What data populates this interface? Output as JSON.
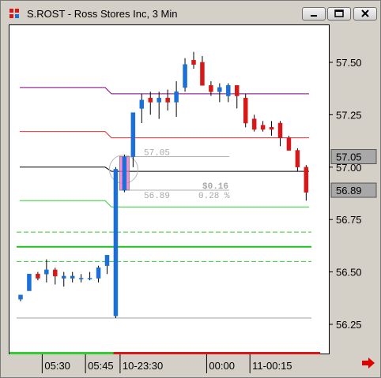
{
  "window": {
    "title": "S.ROST - Ross Stores Inc, 3 Min",
    "buttons": [
      "minimize",
      "restore",
      "close"
    ]
  },
  "chart_data": {
    "type": "candlestick",
    "title": "S.ROST - Ross Stores Inc, 3 Min",
    "ylim": [
      56.22,
      57.62
    ],
    "y_ticks": [
      "57.50",
      "57.25",
      "57.00",
      "56.75",
      "56.50",
      "56.25"
    ],
    "y_tick_values": [
      57.5,
      57.25,
      57.0,
      56.75,
      56.5,
      56.25
    ],
    "x_ticks": [
      "05:30",
      "05:45",
      "10-23:30",
      "00:00",
      "11-00:15"
    ],
    "x_tick_index": [
      2.5,
      7.5,
      11.5,
      21.5,
      26.5
    ],
    "price_flags": [
      {
        "label": "57.05",
        "value": 57.05,
        "color": "#a8a8a8"
      },
      {
        "label": "56.89",
        "value": 56.89,
        "color": "#a8a8a8"
      }
    ],
    "candles": [
      {
        "o": 56.37,
        "h": 56.39,
        "l": 56.36,
        "c": 56.39
      },
      {
        "o": 56.41,
        "h": 56.49,
        "l": 56.41,
        "c": 56.49
      },
      {
        "o": 56.49,
        "h": 56.5,
        "l": 56.46,
        "c": 56.47
      },
      {
        "o": 56.49,
        "h": 56.56,
        "l": 56.45,
        "c": 56.51
      },
      {
        "o": 56.51,
        "h": 56.52,
        "l": 56.44,
        "c": 56.48
      },
      {
        "o": 56.47,
        "h": 56.5,
        "l": 56.43,
        "c": 56.48
      },
      {
        "o": 56.47,
        "h": 56.5,
        "l": 56.45,
        "c": 56.48
      },
      {
        "o": 56.47,
        "h": 56.49,
        "l": 56.45,
        "c": 56.47
      },
      {
        "o": 56.47,
        "h": 56.5,
        "l": 56.46,
        "c": 56.47
      },
      {
        "o": 56.47,
        "h": 56.53,
        "l": 56.45,
        "c": 56.52
      },
      {
        "o": 56.53,
        "h": 56.58,
        "l": 56.49,
        "c": 56.58
      },
      {
        "o": 56.29,
        "h": 57.0,
        "l": 56.28,
        "c": 56.99
      },
      {
        "o": 56.89,
        "h": 57.06,
        "l": 56.88,
        "c": 57.05
      },
      {
        "o": 57.05,
        "h": 57.26,
        "l": 57.0,
        "c": 57.26
      },
      {
        "o": 57.28,
        "h": 57.35,
        "l": 57.21,
        "c": 57.32
      },
      {
        "o": 57.33,
        "h": 57.36,
        "l": 57.25,
        "c": 57.31
      },
      {
        "o": 57.31,
        "h": 57.36,
        "l": 57.23,
        "c": 57.33
      },
      {
        "o": 57.33,
        "h": 57.37,
        "l": 57.27,
        "c": 57.31
      },
      {
        "o": 57.31,
        "h": 57.41,
        "l": 57.24,
        "c": 57.36
      },
      {
        "o": 57.38,
        "h": 57.52,
        "l": 57.36,
        "c": 57.49
      },
      {
        "o": 57.51,
        "h": 57.55,
        "l": 57.47,
        "c": 57.49
      },
      {
        "o": 57.5,
        "h": 57.53,
        "l": 57.39,
        "c": 57.39
      },
      {
        "o": 57.39,
        "h": 57.41,
        "l": 57.34,
        "c": 57.36
      },
      {
        "o": 57.36,
        "h": 57.4,
        "l": 57.31,
        "c": 57.38
      },
      {
        "o": 57.34,
        "h": 57.4,
        "l": 57.31,
        "c": 57.39
      },
      {
        "o": 57.39,
        "h": 57.39,
        "l": 57.28,
        "c": 57.34
      },
      {
        "o": 57.33,
        "h": 57.35,
        "l": 57.19,
        "c": 57.21
      },
      {
        "o": 57.23,
        "h": 57.25,
        "l": 57.17,
        "c": 57.18
      },
      {
        "o": 57.2,
        "h": 57.22,
        "l": 57.17,
        "c": 57.18
      },
      {
        "o": 57.19,
        "h": 57.22,
        "l": 57.15,
        "c": 57.18
      },
      {
        "o": 57.21,
        "h": 57.22,
        "l": 57.1,
        "c": 57.14
      },
      {
        "o": 57.14,
        "h": 57.15,
        "l": 57.08,
        "c": 57.08
      },
      {
        "o": 57.08,
        "h": 57.09,
        "l": 56.98,
        "c": 57.0
      },
      {
        "o": 57.0,
        "h": 57.01,
        "l": 56.84,
        "c": 56.88
      }
    ],
    "candle_colors": {
      "up": "#1c6fd6",
      "down": "#d81818"
    },
    "highlight_candle_index": 12,
    "level_lines": [
      {
        "value": 57.38,
        "color": "#800080",
        "start_index": -2,
        "break_index": 10.5,
        "value_after": 57.35
      },
      {
        "value": 57.17,
        "color": "#e03030",
        "start_index": -2,
        "break_index": 10.5,
        "value_after": 57.14
      },
      {
        "value": 57.0,
        "color": "#000000",
        "start_index": -2,
        "break_index": 10.5,
        "value_after": 56.98
      },
      {
        "value": 56.84,
        "color": "#33cc33",
        "start_index": -2,
        "break_index": 10.5,
        "value_after": 56.81
      }
    ],
    "horizontal_lines": [
      {
        "value": 56.69,
        "color": "#33cc33",
        "style": "dashed"
      },
      {
        "value": 56.62,
        "color": "#1fbf1f",
        "style": "solid-bold"
      },
      {
        "value": 56.55,
        "color": "#33cc33",
        "style": "dashed"
      },
      {
        "value": 56.28,
        "color": "#a0a0a0",
        "style": "solid"
      }
    ],
    "measure_tool": {
      "start_label": "57.05",
      "end_label": "56.89",
      "change_label": "$0.16",
      "percent_label": "0.28 %"
    },
    "session_bar": {
      "green_until_index": 11,
      "colors": [
        "#33cc33",
        "#d81818"
      ]
    }
  }
}
